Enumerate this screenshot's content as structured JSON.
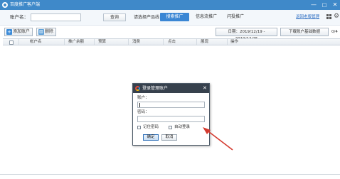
{
  "window": {
    "title": "百度推广客户端",
    "minimize": "—",
    "maximize": "□",
    "close": "✕"
  },
  "filter": {
    "account_label": "账户名：",
    "search_button": "查询",
    "product_label": "请选择产品线：",
    "segments": [
      "搜索推广",
      "信息流推广",
      "闪投推广"
    ],
    "active_segment": 0,
    "link": "返回老版管理"
  },
  "toolbar": {
    "add_account": "添加账户",
    "delete": "删除",
    "date_range": "日期：2019/12/19 - 2019/12/25",
    "download": "下载账户基础数据",
    "page_count": "0/4"
  },
  "table": {
    "columns": [
      "帐户名",
      "推广余额",
      "预算",
      "消费",
      "点击",
      "展现",
      "操作"
    ],
    "rows": []
  },
  "dialog": {
    "title": "登录管理账户",
    "account_label": "账户：",
    "account_value": "",
    "password_label": "密码：",
    "password_value": "",
    "remember_password": "记住密码",
    "remember_checked": false,
    "auto_login": "自动登录",
    "auto_checked": false,
    "ok": "确定",
    "cancel": "取消",
    "close": "✕"
  },
  "colors": {
    "title_bar": "#3f89c9",
    "active_tab": "#3a86d4",
    "dialog_title": "#37414d",
    "annotation_arrow": "#d43a2f"
  },
  "icons": {
    "app": "baidu-app-icon",
    "add": "add-icon",
    "delete": "trash-icon",
    "view": "grid-icon",
    "settings": "gear-icon",
    "dialog_logo": "baidu-logo-icon"
  }
}
